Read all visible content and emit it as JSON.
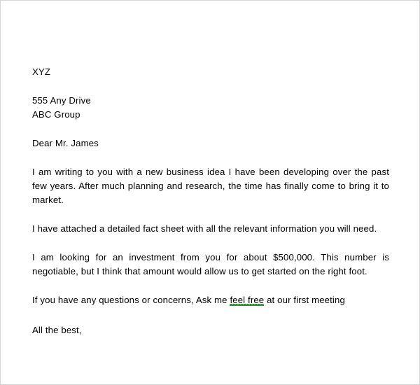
{
  "document": {
    "type": "business-letter",
    "page_background": "#ffffff",
    "border_color": "#d4d4d4",
    "text_color": "#000000",
    "spellcheck_underline_color": "#2e8b2e"
  },
  "letter": {
    "sender_name": "XYZ",
    "address": {
      "street": "555 Any Drive",
      "organization": "ABC Group"
    },
    "salutation": "Dear Mr. James",
    "paragraphs": [
      {
        "id": "intro",
        "text": "I am writing to you with a new business idea I have been developing over the past few years. After much planning and research, the time has finally come to bring it to market."
      },
      {
        "id": "attachment",
        "text": "I have attached a detailed fact sheet with all the relevant information you will need."
      },
      {
        "id": "investment",
        "text": "I am looking for an investment from you for about $500,000. This number is negotiable, but I think that amount would allow us to get started on the right foot."
      }
    ],
    "closing_paragraph": {
      "id": "questions",
      "before_marked": "If you have any questions or concerns, Ask me ",
      "marked_text": "feel free",
      "after_marked": " at our first meeting"
    },
    "sign_off": "All the best,"
  }
}
